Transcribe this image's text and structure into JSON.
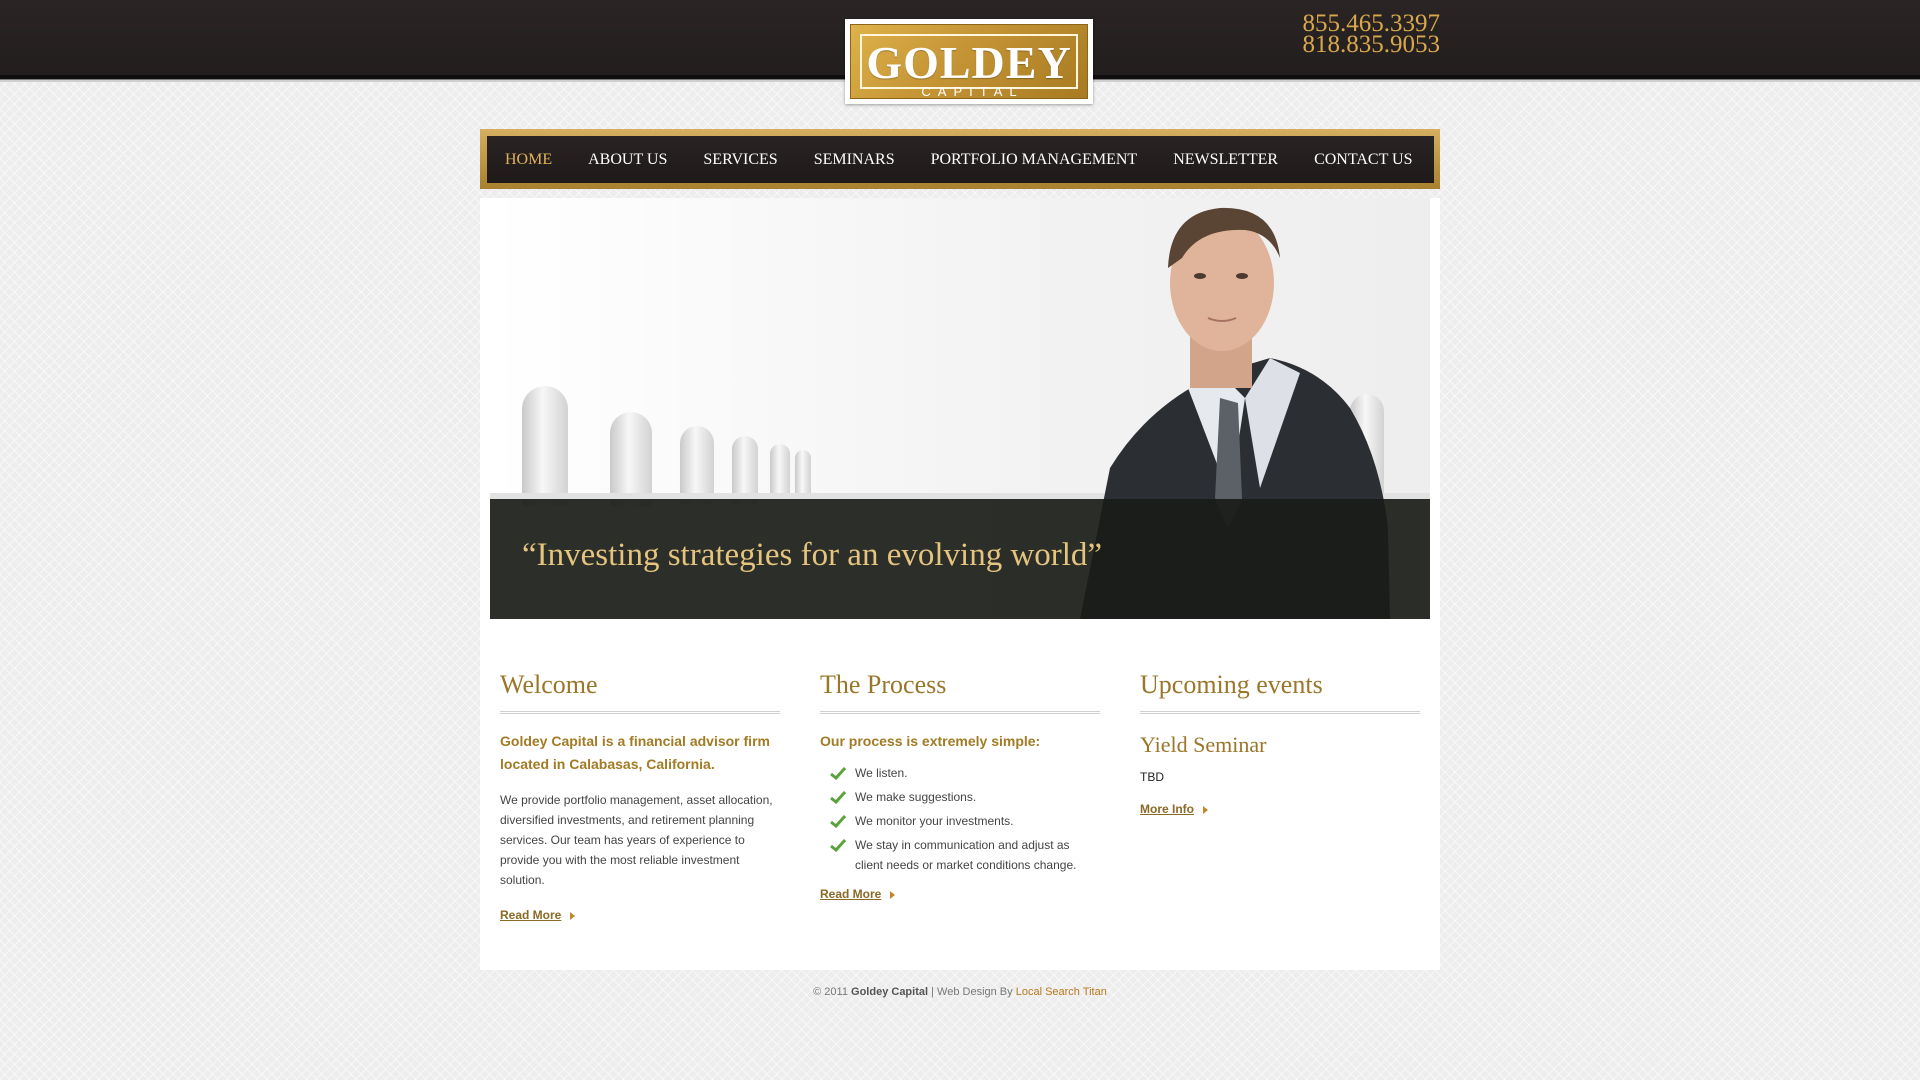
{
  "header": {
    "logo": {
      "word": "GOLDEY",
      "sub": "CAPITAL"
    },
    "phones": [
      "855.465.3397",
      "818.835.9053"
    ]
  },
  "nav": {
    "items": [
      {
        "label": "HOME",
        "active": true
      },
      {
        "label": "ABOUT US"
      },
      {
        "label": "SERVICES"
      },
      {
        "label": "SEMINARS"
      },
      {
        "label": "PORTFOLIO MANAGEMENT"
      },
      {
        "label": "NEWSLETTER"
      },
      {
        "label": "CONTACT US"
      }
    ]
  },
  "hero": {
    "quote": "“Investing strategies for an evolving world”"
  },
  "welcome": {
    "title": "Welcome",
    "lead": "Goldey Capital is a financial advisor firm located in Calabasas, California.",
    "body": "We provide portfolio management, asset allocation, diversified investments, and retirement planning services. Our team has years of experience to provide you with the most reliable investment solution.",
    "link": "Read More"
  },
  "process": {
    "title": "The Process",
    "lead": "Our process is extremely simple:",
    "steps": [
      "We listen.",
      "We make suggestions.",
      "We monitor your investments.",
      "We stay in communication and adjust as client needs or market conditions change."
    ],
    "link": "Read More"
  },
  "events": {
    "title": "Upcoming events",
    "event_title": "Yield Seminar",
    "event_date": "TBD",
    "link": "More Info"
  },
  "footer": {
    "copyright": "© 2011",
    "company": "Goldey Capital",
    "separator": "| Web Design By",
    "designer": "Local Search Titan"
  },
  "colors": {
    "gold": "#9a762a",
    "dark": "#231e1e",
    "accent": "#e2b25a"
  }
}
